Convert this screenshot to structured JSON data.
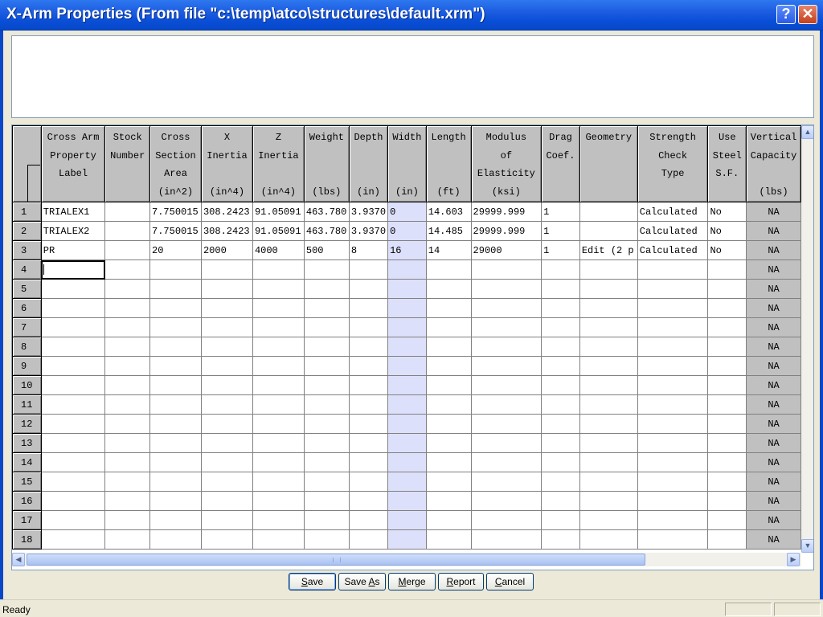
{
  "window": {
    "title": "X-Arm Properties (From file \"c:\\temp\\atco\\structures\\default.xrm\")",
    "help_glyph": "?",
    "close_glyph": "✕"
  },
  "grid": {
    "columns": [
      {
        "key": "label",
        "header": "Cross Arm\nProperty\nLabel"
      },
      {
        "key": "stock",
        "header": "Stock\nNumber"
      },
      {
        "key": "area",
        "header": "Cross\nSection\nArea\n(in^2)"
      },
      {
        "key": "xinertia",
        "header": "X\nInertia\n\n(in^4)"
      },
      {
        "key": "zinertia",
        "header": "Z\nInertia\n\n(in^4)"
      },
      {
        "key": "weight",
        "header": "Weight\n\n\n(lbs)"
      },
      {
        "key": "depth",
        "header": "Depth\n\n\n(in)"
      },
      {
        "key": "width",
        "header": "Width\n\n\n(in)"
      },
      {
        "key": "length",
        "header": "Length\n\n\n(ft)"
      },
      {
        "key": "modulus",
        "header": "Modulus\nof\nElasticity\n(ksi)"
      },
      {
        "key": "drag",
        "header": "Drag\nCoef."
      },
      {
        "key": "geometry",
        "header": "Geometry"
      },
      {
        "key": "strength",
        "header": "Strength\nCheck\nType"
      },
      {
        "key": "steelsf",
        "header": "Use\nSteel\nS.F."
      },
      {
        "key": "vcap",
        "header": "Vertical\nCapacity\n\n(lbs)"
      }
    ],
    "rows": [
      {
        "num": "1",
        "cells": [
          "TRIALEX1",
          "",
          "7.750015",
          "308.2423",
          "91.05091",
          "463.780",
          "3.9370",
          "0",
          "14.603",
          "29999.999",
          "1",
          "",
          "Calculated",
          "No",
          "NA"
        ]
      },
      {
        "num": "2",
        "cells": [
          "TRIALEX2",
          "",
          "7.750015",
          "308.2423",
          "91.05091",
          "463.780",
          "3.9370",
          "0",
          "14.485",
          "29999.999",
          "1",
          "",
          "Calculated",
          "No",
          "NA"
        ]
      },
      {
        "num": "3",
        "cells": [
          "PR",
          "",
          "20",
          "2000",
          "4000",
          "500",
          "8",
          "16",
          "14",
          "29000",
          "1",
          "Edit (2 p",
          "Calculated",
          "No",
          "NA"
        ]
      },
      {
        "num": "4",
        "cells": [
          "",
          "",
          "",
          "",
          "",
          "",
          "",
          "",
          "",
          "",
          "",
          "",
          "",
          "",
          "NA"
        ]
      },
      {
        "num": "5",
        "cells": [
          "",
          "",
          "",
          "",
          "",
          "",
          "",
          "",
          "",
          "",
          "",
          "",
          "",
          "",
          "NA"
        ]
      },
      {
        "num": "6",
        "cells": [
          "",
          "",
          "",
          "",
          "",
          "",
          "",
          "",
          "",
          "",
          "",
          "",
          "",
          "",
          "NA"
        ]
      },
      {
        "num": "7",
        "cells": [
          "",
          "",
          "",
          "",
          "",
          "",
          "",
          "",
          "",
          "",
          "",
          "",
          "",
          "",
          "NA"
        ]
      },
      {
        "num": "8",
        "cells": [
          "",
          "",
          "",
          "",
          "",
          "",
          "",
          "",
          "",
          "",
          "",
          "",
          "",
          "",
          "NA"
        ]
      },
      {
        "num": "9",
        "cells": [
          "",
          "",
          "",
          "",
          "",
          "",
          "",
          "",
          "",
          "",
          "",
          "",
          "",
          "",
          "NA"
        ]
      },
      {
        "num": "10",
        "cells": [
          "",
          "",
          "",
          "",
          "",
          "",
          "",
          "",
          "",
          "",
          "",
          "",
          "",
          "",
          "NA"
        ]
      },
      {
        "num": "11",
        "cells": [
          "",
          "",
          "",
          "",
          "",
          "",
          "",
          "",
          "",
          "",
          "",
          "",
          "",
          "",
          "NA"
        ]
      },
      {
        "num": "12",
        "cells": [
          "",
          "",
          "",
          "",
          "",
          "",
          "",
          "",
          "",
          "",
          "",
          "",
          "",
          "",
          "NA"
        ]
      },
      {
        "num": "13",
        "cells": [
          "",
          "",
          "",
          "",
          "",
          "",
          "",
          "",
          "",
          "",
          "",
          "",
          "",
          "",
          "NA"
        ]
      },
      {
        "num": "14",
        "cells": [
          "",
          "",
          "",
          "",
          "",
          "",
          "",
          "",
          "",
          "",
          "",
          "",
          "",
          "",
          "NA"
        ]
      },
      {
        "num": "15",
        "cells": [
          "",
          "",
          "",
          "",
          "",
          "",
          "",
          "",
          "",
          "",
          "",
          "",
          "",
          "",
          "NA"
        ]
      },
      {
        "num": "16",
        "cells": [
          "",
          "",
          "",
          "",
          "",
          "",
          "",
          "",
          "",
          "",
          "",
          "",
          "",
          "",
          "NA"
        ]
      },
      {
        "num": "17",
        "cells": [
          "",
          "",
          "",
          "",
          "",
          "",
          "",
          "",
          "",
          "",
          "",
          "",
          "",
          "",
          "NA"
        ]
      },
      {
        "num": "18",
        "cells": [
          "",
          "",
          "",
          "",
          "",
          "",
          "",
          "",
          "",
          "",
          "",
          "",
          "",
          "",
          "NA"
        ]
      }
    ],
    "active_cell": {
      "row": "4",
      "column": "label"
    },
    "highlight_column": "width",
    "colors": {
      "highlight": "#dde0fb",
      "header": "#c0c0c0"
    }
  },
  "buttons": {
    "save": {
      "mnemonic": "S",
      "rest": "ave"
    },
    "save_as": {
      "pre": "Save ",
      "mnemonic": "A",
      "rest": "s"
    },
    "merge": {
      "mnemonic": "M",
      "rest": "erge"
    },
    "report": {
      "mnemonic": "R",
      "rest": "eport"
    },
    "cancel": {
      "mnemonic": "C",
      "rest": "ancel"
    }
  },
  "status": {
    "text": "Ready"
  }
}
